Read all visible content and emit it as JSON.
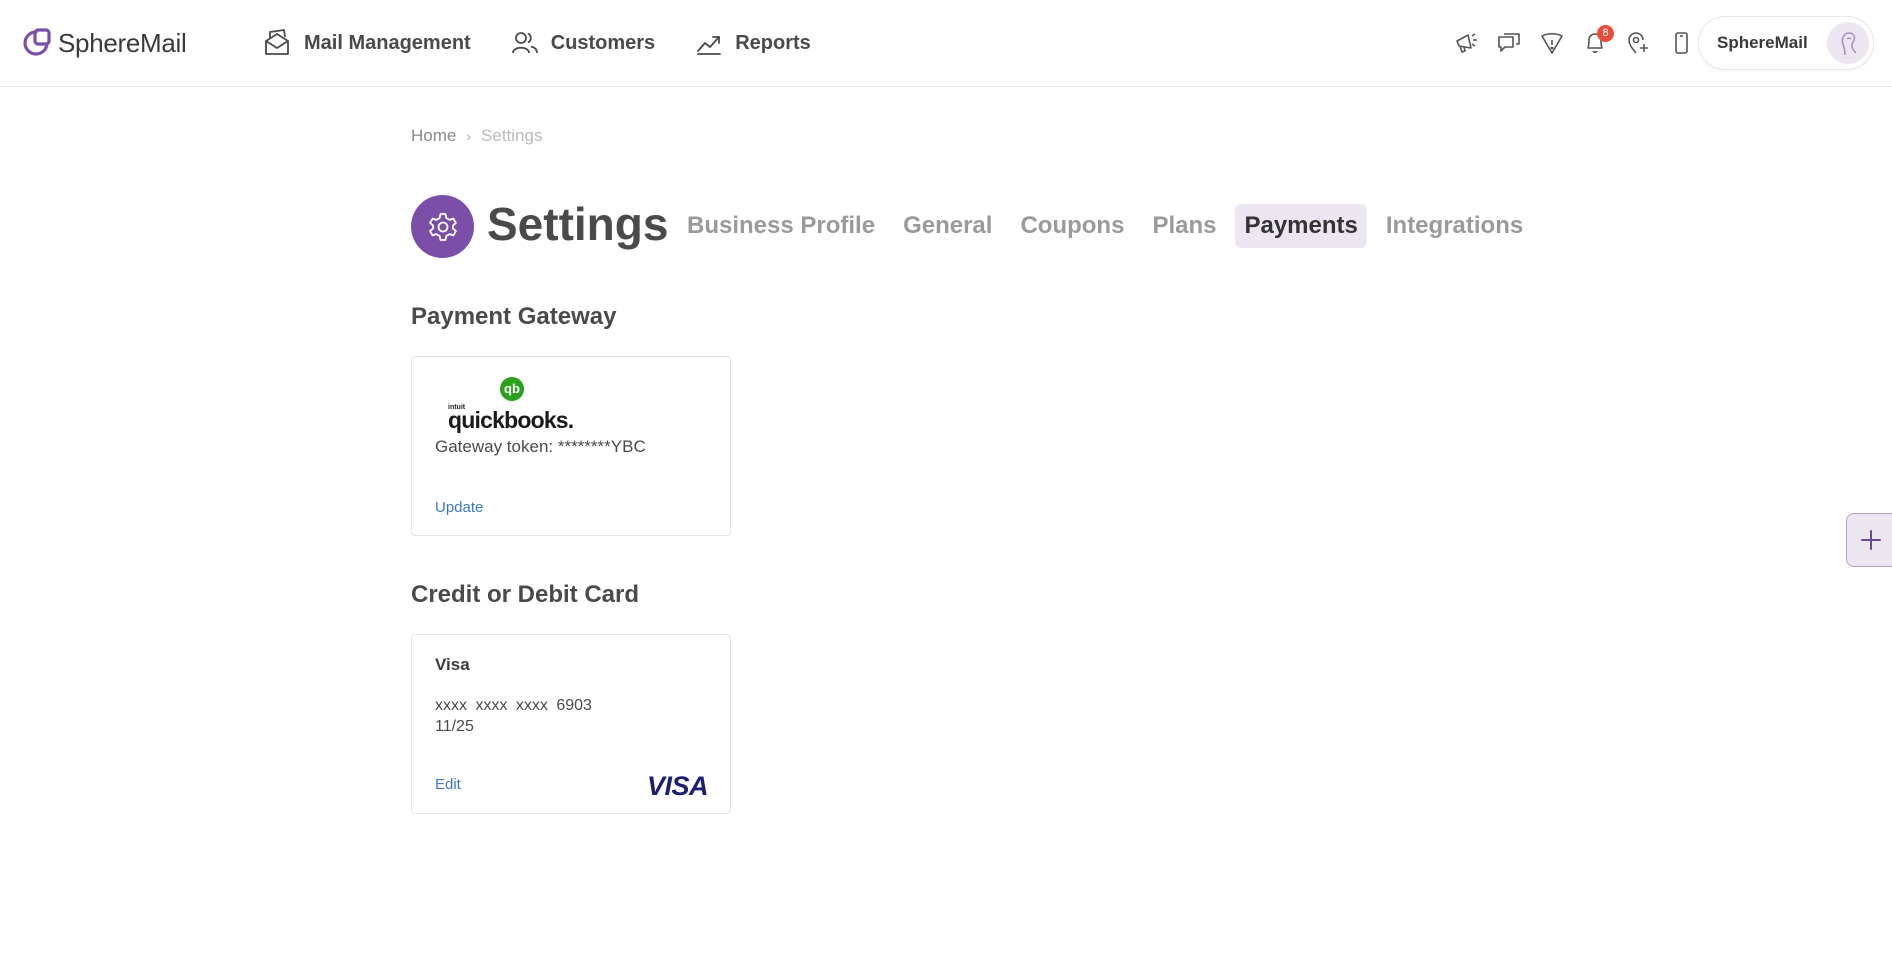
{
  "app": {
    "name": "SphereMail",
    "accent_color": "#7b4fa7",
    "active_tab_bg": "#ece6f1"
  },
  "nav": {
    "items": [
      {
        "label": "Mail Management",
        "icon": "mail-stack-icon"
      },
      {
        "label": "Customers",
        "icon": "users-icon"
      },
      {
        "label": "Reports",
        "icon": "trend-chart-icon"
      }
    ]
  },
  "toolbar": {
    "icons": [
      "megaphone-icon",
      "chat-icon",
      "shield-alert-icon",
      "bell-icon",
      "location-add-icon",
      "mobile-icon"
    ],
    "notification_count": "8"
  },
  "account": {
    "name": "SphereMail",
    "avatar_icon": "user-avatar-icon"
  },
  "breadcrumb": {
    "home": "Home",
    "separator": "›",
    "current": "Settings"
  },
  "header": {
    "title": "Settings",
    "icon": "gear-icon",
    "tabs": [
      {
        "label": "Business Profile",
        "active": false
      },
      {
        "label": "General",
        "active": false
      },
      {
        "label": "Coupons",
        "active": false
      },
      {
        "label": "Plans",
        "active": false
      },
      {
        "label": "Payments",
        "active": true
      },
      {
        "label": "Integrations",
        "active": false
      }
    ]
  },
  "payment_gateway": {
    "section_title": "Payment Gateway",
    "provider_logo": {
      "mark": "qb",
      "small": "intuit",
      "word": "quickbooks."
    },
    "token_text": "Gateway token: ********YBC",
    "update_label": "Update",
    "link_color": "#3b79c2"
  },
  "card_section": {
    "section_title": "Credit or Debit Card",
    "brand": "Visa",
    "number": "xxxx  xxxx  xxxx  6903",
    "expiry": "11/25",
    "edit_label": "Edit",
    "logo_text": "VISA",
    "logo_color": "#1a1f71"
  },
  "fab": {
    "icon": "plus-icon"
  }
}
